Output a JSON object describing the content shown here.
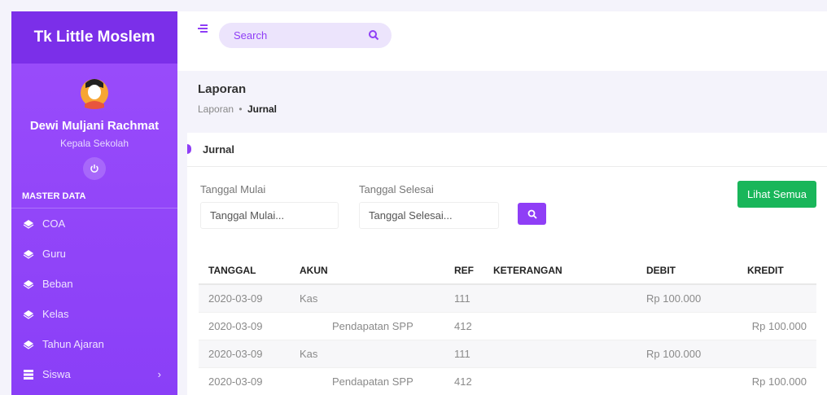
{
  "app": {
    "title": "Tk Little Moslem"
  },
  "user": {
    "name": "Dewi Muljani Rachmat",
    "role": "Kepala Sekolah"
  },
  "sidebar": {
    "section": "MASTER DATA",
    "items": [
      {
        "label": "COA",
        "icon": "layers-icon"
      },
      {
        "label": "Guru",
        "icon": "layers-icon"
      },
      {
        "label": "Beban",
        "icon": "layers-icon"
      },
      {
        "label": "Kelas",
        "icon": "layers-icon"
      },
      {
        "label": "Tahun Ajaran",
        "icon": "layers-icon"
      },
      {
        "label": "Siswa",
        "icon": "table-icon",
        "chevron": "›"
      }
    ]
  },
  "topbar": {
    "search_label": "Search"
  },
  "header": {
    "title": "Laporan",
    "breadcrumb": {
      "parent": "Laporan",
      "separator": "•",
      "current": "Jurnal"
    }
  },
  "card": {
    "title": "Jurnal",
    "start_label": "Tanggal Mulai",
    "start_placeholder": "Tanggal Mulai...",
    "end_label": "Tanggal Selesai",
    "end_placeholder": "Tanggal Selesai...",
    "show_all_label": "Lihat Semua"
  },
  "table": {
    "headers": [
      "TANGGAL",
      "AKUN",
      "REF",
      "KETERANGAN",
      "DEBIT",
      "KREDIT"
    ],
    "rows": [
      {
        "tanggal": "2020-03-09",
        "akun": "Kas",
        "ref": "111",
        "keterangan": "",
        "debit": "Rp 100.000",
        "kredit": ""
      },
      {
        "tanggal": "2020-03-09",
        "akun": "Pendapatan SPP",
        "ref": "412",
        "keterangan": "",
        "debit": "",
        "kredit": "Rp 100.000"
      },
      {
        "tanggal": "2020-03-09",
        "akun": "Kas",
        "ref": "111",
        "keterangan": "",
        "debit": "Rp 100.000",
        "kredit": ""
      },
      {
        "tanggal": "2020-03-09",
        "akun": "Pendapatan SPP",
        "ref": "412",
        "keterangan": "",
        "debit": "",
        "kredit": "Rp 100.000"
      }
    ]
  },
  "colors": {
    "accent": "#8f3ef6",
    "success": "#19b65a",
    "sidebar": "#9b4dfb"
  }
}
